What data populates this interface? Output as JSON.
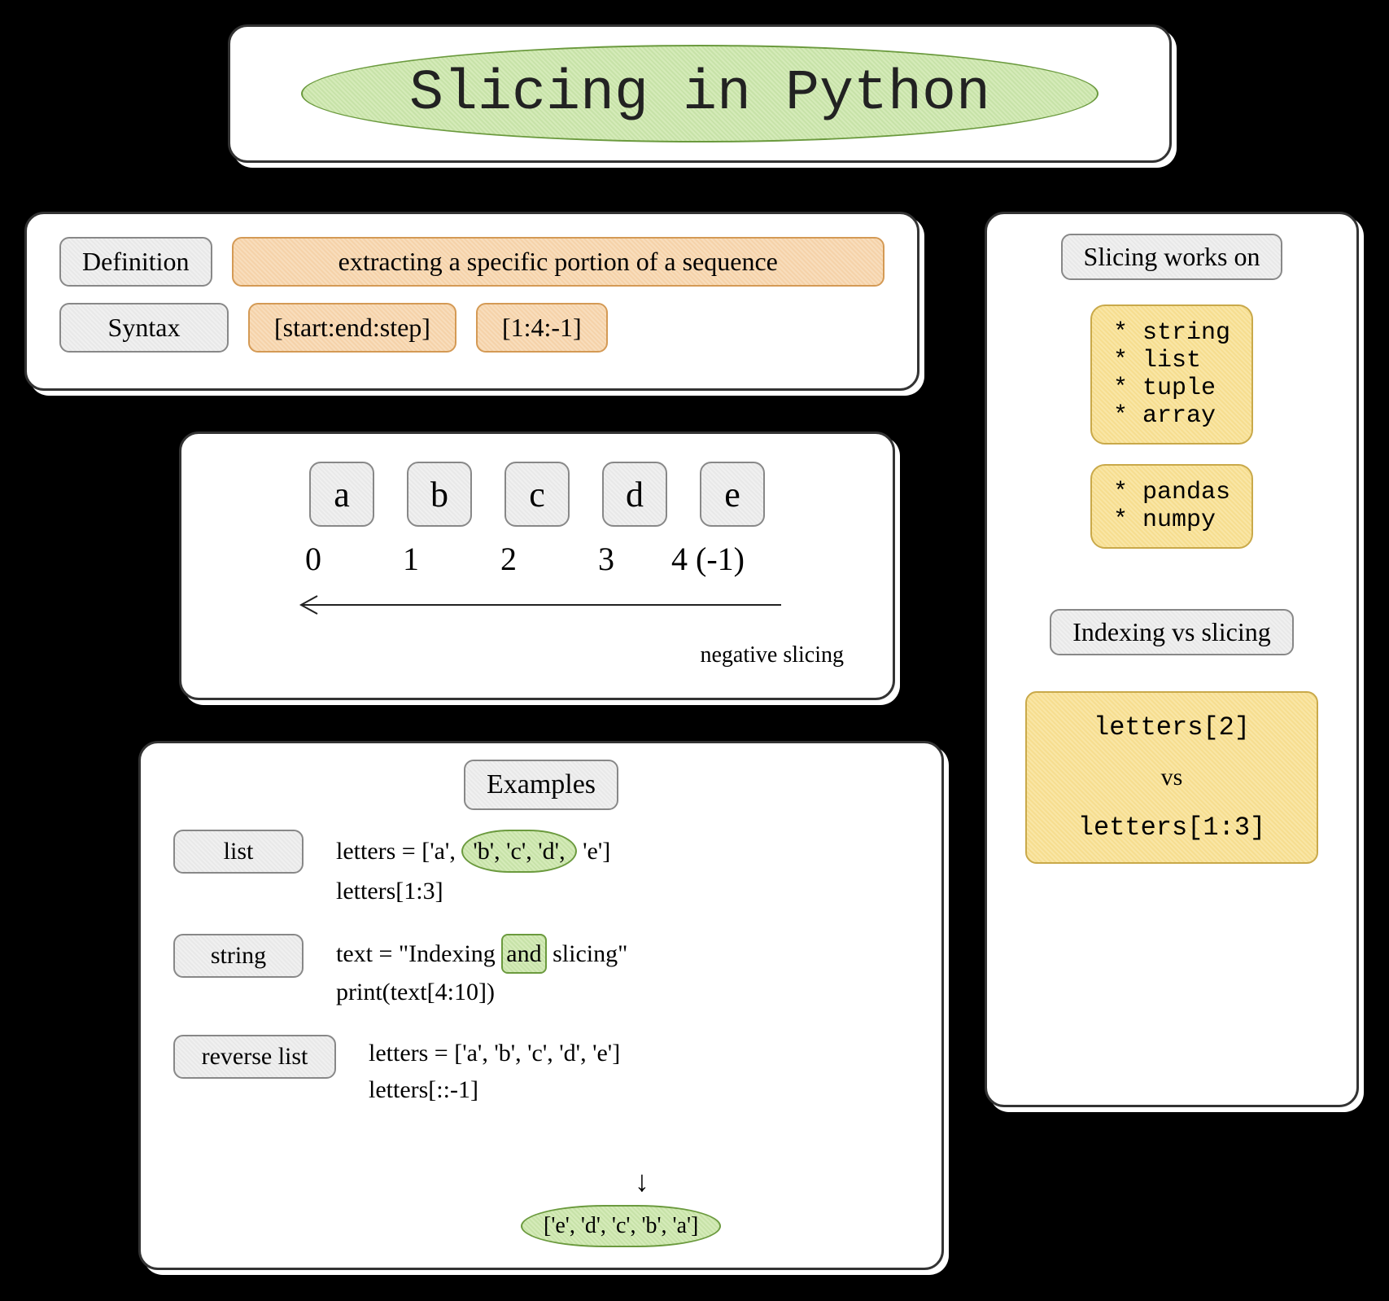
{
  "title": "Slicing in Python",
  "definition": {
    "label": "Definition",
    "text": "extracting a specific portion of a sequence"
  },
  "syntax": {
    "label": "Syntax",
    "pattern": "[start:end:step]",
    "example": "[1:4:-1]"
  },
  "index_demo": {
    "letters": [
      "a",
      "b",
      "c",
      "d",
      "e"
    ],
    "indices": [
      "0",
      "1",
      "2",
      "3"
    ],
    "last_index": "4 (-1)",
    "negative_label": "negative slicing"
  },
  "examples": {
    "heading": "Examples",
    "list": {
      "label": "list",
      "line_prefix": "letters = ['a', ",
      "highlight": "'b', 'c', 'd',",
      "line_suffix": " 'e']",
      "line2": "letters[1:3]"
    },
    "string": {
      "label": "string",
      "line_prefix": "text = \"Indexing ",
      "highlight": "and",
      "line_suffix": " slicing\"",
      "line2": "print(text[4:10])"
    },
    "reverse": {
      "label": "reverse list",
      "line1": "letters = ['a', 'b', 'c', 'd', 'e']",
      "line2": "letters[::-1]",
      "result": "['e', 'd', 'c', 'b', 'a']"
    }
  },
  "works_on": {
    "heading": "Slicing works on",
    "group1": [
      "string",
      "list",
      "tuple",
      "array"
    ],
    "group2": [
      "pandas",
      "numpy"
    ]
  },
  "indexing_vs": {
    "heading": "Indexing vs slicing",
    "top": "letters[2]",
    "vs": "vs",
    "bottom": "letters[1:3]"
  }
}
